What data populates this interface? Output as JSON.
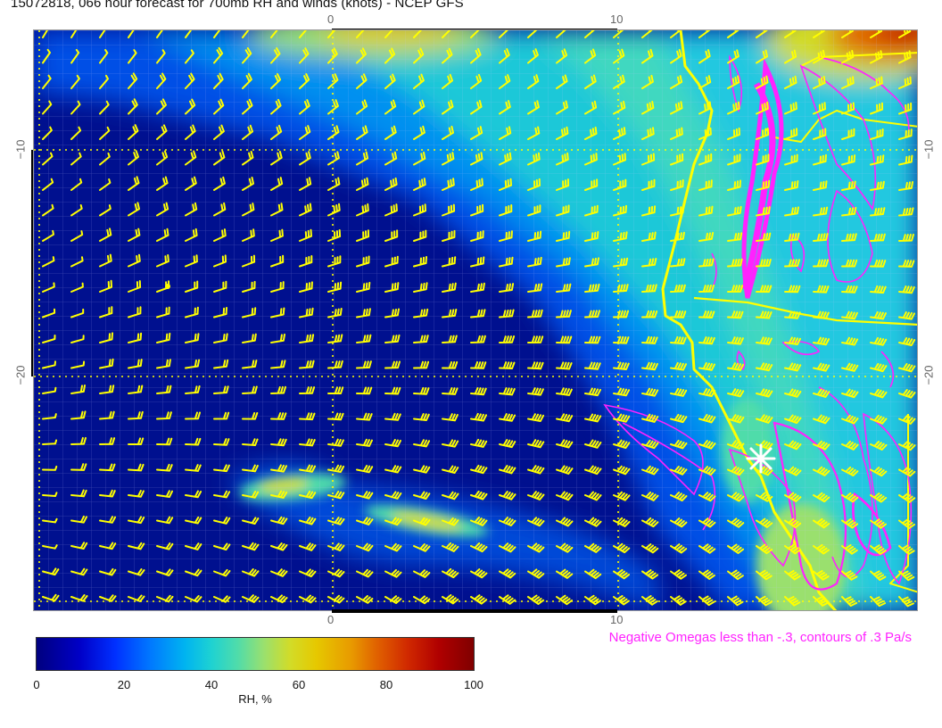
{
  "title": "15072818, 066 hour forecast for 700mb RH and winds (knots) - NCEP GFS",
  "axes": {
    "top_ticks": [
      "0",
      "10"
    ],
    "bottom_ticks": [
      "0",
      "10"
    ],
    "left_ticks": [
      "−10",
      "−20"
    ],
    "right_ticks": [
      "−10",
      "−20"
    ]
  },
  "colorbar": {
    "label": "RH, %",
    "ticks": [
      "0",
      "20",
      "40",
      "60",
      "80",
      "100"
    ],
    "colors": [
      "#00007f",
      "#0000c8",
      "#0030ff",
      "#0078ff",
      "#00b4f0",
      "#1ed2d2",
      "#50dcaa",
      "#9ae06e",
      "#d2dc28",
      "#e6c800",
      "#e89a00",
      "#e06000",
      "#d02800",
      "#b00000",
      "#800000"
    ]
  },
  "omega_note": "Negative Omegas less than -.3, contours of .3 Pa/s",
  "colors": {
    "wind_barb": "#ffff00",
    "coastline": "#ffff00",
    "omega_contour": "#ff22ff",
    "gridline": "#c8c8ff"
  },
  "map": {
    "variable": "700mb relative humidity",
    "units": "%",
    "overlay": "wind barbs (knots)",
    "marker_icon": "white-star-icon"
  }
}
